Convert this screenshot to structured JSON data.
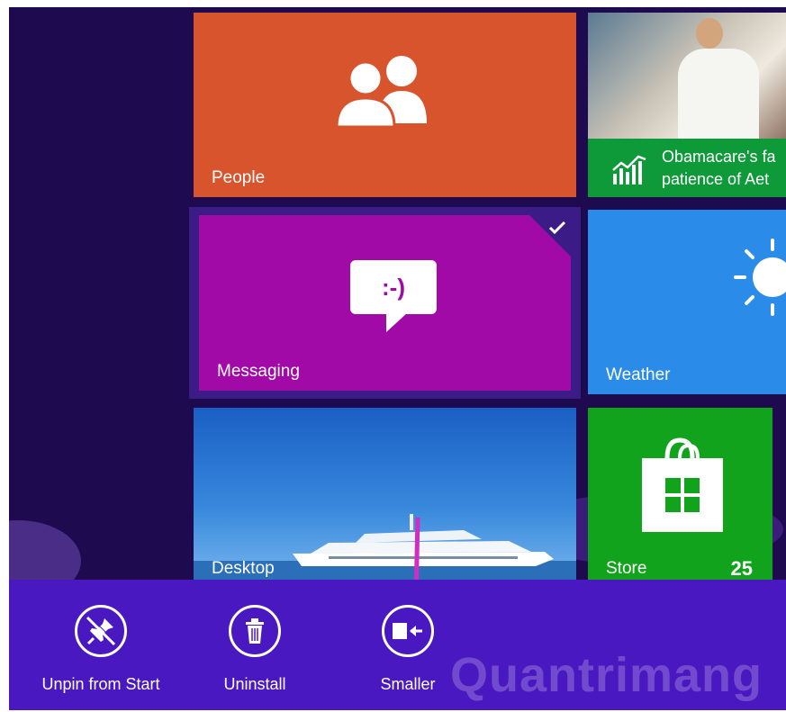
{
  "tiles": {
    "people": {
      "label": "People",
      "icon": "people-icon"
    },
    "news": {
      "headline_line1": "Obamacare's fa",
      "headline_line2": "patience of Aet",
      "icon": "finance-chart-icon"
    },
    "messaging": {
      "label": "Messaging",
      "icon": "smiley-chat-icon",
      "emoticon": ":-)",
      "selected": true
    },
    "weather": {
      "label": "Weather",
      "icon": "sun-icon"
    },
    "desktop": {
      "label": "Desktop"
    },
    "store": {
      "label": "Store",
      "badge": "25",
      "icon": "store-bag-icon"
    }
  },
  "app_bar": {
    "commands": [
      {
        "label": "Unpin from Start",
        "icon": "unpin-icon"
      },
      {
        "label": "Uninstall",
        "icon": "trash-icon"
      },
      {
        "label": "Smaller",
        "icon": "resize-smaller-icon"
      }
    ]
  },
  "watermark": "Quantrimang",
  "colors": {
    "start_bg": "#1d0a4f",
    "people": "#d8542c",
    "messaging": "#a10aa6",
    "weather": "#2a8be8",
    "store": "#12a31c",
    "news_band": "#0f9a3a",
    "app_bar": "#4a18c0",
    "arrow": "#d02ec0"
  }
}
